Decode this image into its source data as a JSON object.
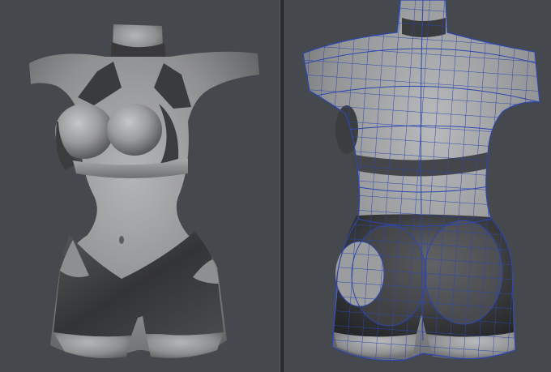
{
  "viewports": {
    "left": {
      "shading": "solid"
    },
    "right": {
      "shading": "wireframe-on-shaded"
    }
  },
  "colors": {
    "background": "#45494d",
    "skin": "#9a9b9c",
    "clothing": "#3e3f41",
    "wireframe": "#2e46b0",
    "splitter": "#2a2c2f"
  }
}
